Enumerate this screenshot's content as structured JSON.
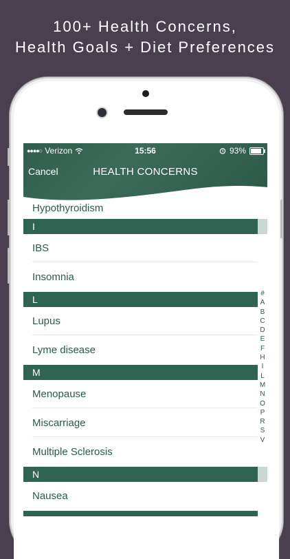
{
  "promo": {
    "line1": "100+ Health Concerns,",
    "line2": "Health Goals + Diet Preferences"
  },
  "status_bar": {
    "carrier": "Verizon",
    "time": "15:56",
    "battery": "93%"
  },
  "nav": {
    "cancel": "Cancel",
    "title": "HEALTH CONCERNS"
  },
  "list": {
    "partial_item": "Hypothyroidism",
    "sections": [
      {
        "letter": "I",
        "items": [
          "IBS",
          "Insomnia"
        ]
      },
      {
        "letter": "L",
        "items": [
          "Lupus",
          "Lyme disease"
        ]
      },
      {
        "letter": "M",
        "items": [
          "Menopause",
          "Miscarriage",
          "Multiple Sclerosis"
        ]
      },
      {
        "letter": "N",
        "items": [
          "Nausea"
        ]
      }
    ]
  },
  "index_letters": [
    "#",
    "A",
    "B",
    "C",
    "D",
    "E",
    "F",
    "H",
    "I",
    "L",
    "M",
    "N",
    "O",
    "P",
    "R",
    "S",
    "V"
  ],
  "colors": {
    "accent": "#2f6352",
    "background": "#4a3f4f"
  }
}
